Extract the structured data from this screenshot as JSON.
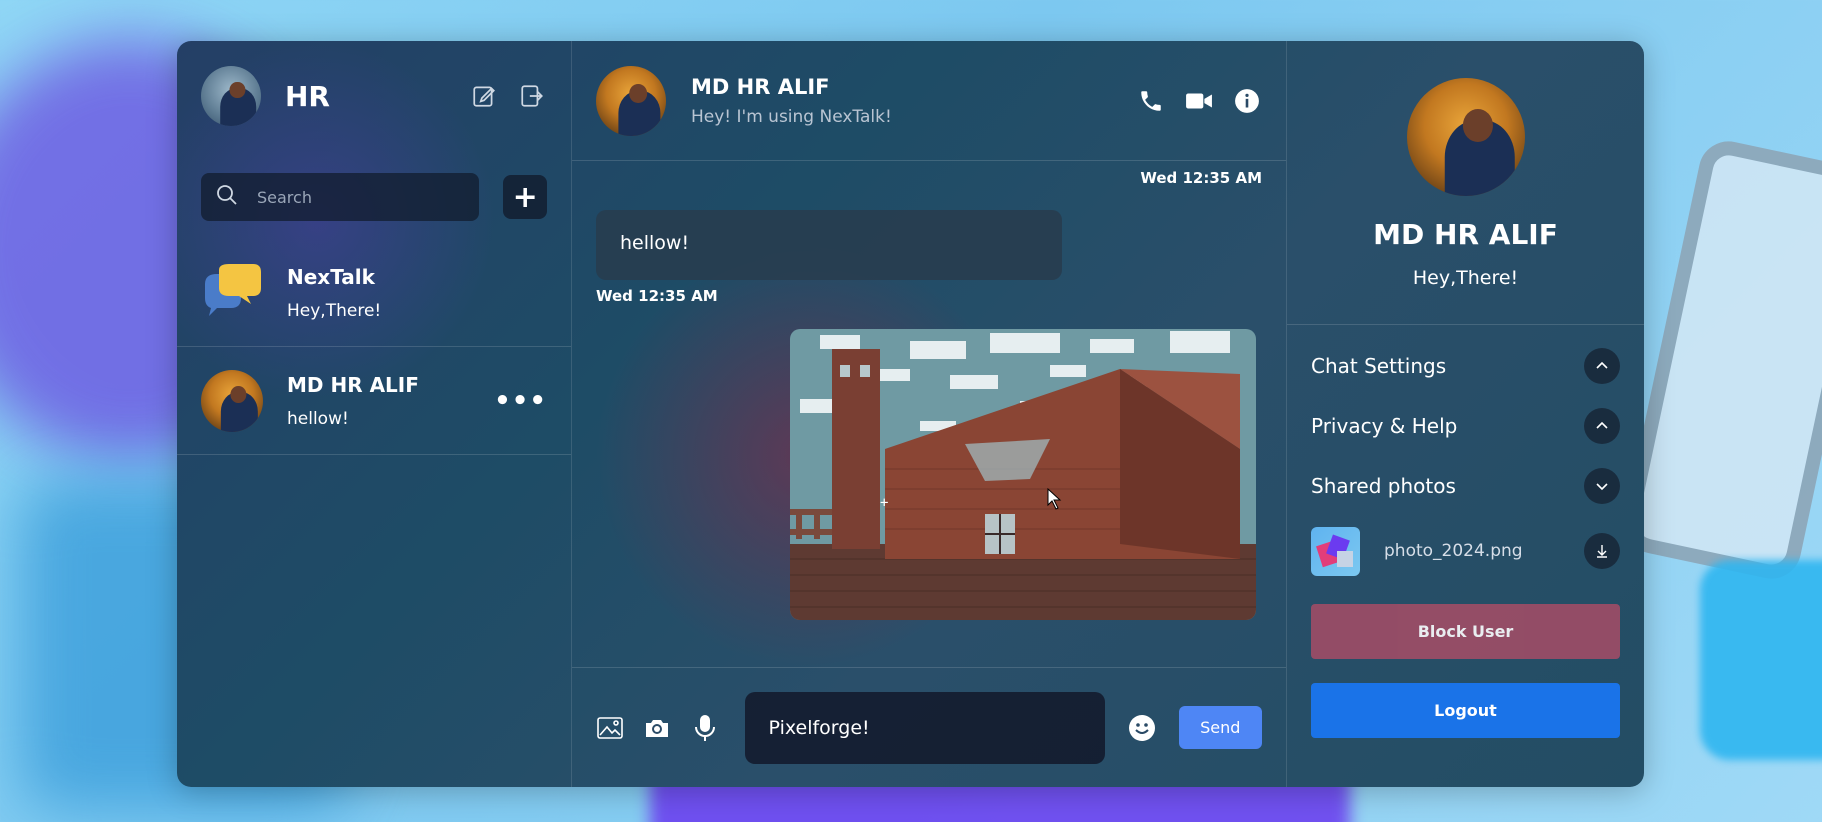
{
  "sidebar": {
    "title": "HR",
    "search": {
      "placeholder": "Search",
      "value": ""
    },
    "add_label": "+",
    "chats": [
      {
        "name": "NexTalk",
        "last_message": "Hey,There!"
      },
      {
        "name": "MD HR ALIF",
        "last_message": "hellow!",
        "more": "•••"
      }
    ]
  },
  "chat": {
    "contact_name": "MD HR ALIF",
    "contact_status": "Hey! I'm using NexTalk!",
    "messages": [
      {
        "type": "text",
        "text": "hellow!",
        "timestamp": "Wed 12:35 AM"
      },
      {
        "type": "image",
        "timestamp": "Wed 12:35 AM"
      }
    ],
    "composer": {
      "value": "Pixelforge!",
      "send_label": "Send"
    }
  },
  "details": {
    "name": "MD HR ALIF",
    "status": "Hey,There!",
    "sections": [
      {
        "label": "Chat Settings",
        "state": "collapsed-up"
      },
      {
        "label": "Privacy & Help",
        "state": "collapsed-up"
      },
      {
        "label": "Shared photos",
        "state": "expanded"
      }
    ],
    "shared_photos": [
      {
        "file_name": "photo_2024.png"
      }
    ],
    "block_label": "Block User",
    "logout_label": "Logout"
  },
  "colors": {
    "accent_send": "#4e86f5",
    "logout": "#1a73e8",
    "block": "#a04d66"
  },
  "icons": [
    "edit-icon",
    "logout-icon",
    "search-icon",
    "phone-icon",
    "video-icon",
    "info-icon",
    "image-icon",
    "camera-icon",
    "mic-icon",
    "emoji-icon",
    "chevron-up-icon",
    "chevron-down-icon",
    "download-icon"
  ]
}
